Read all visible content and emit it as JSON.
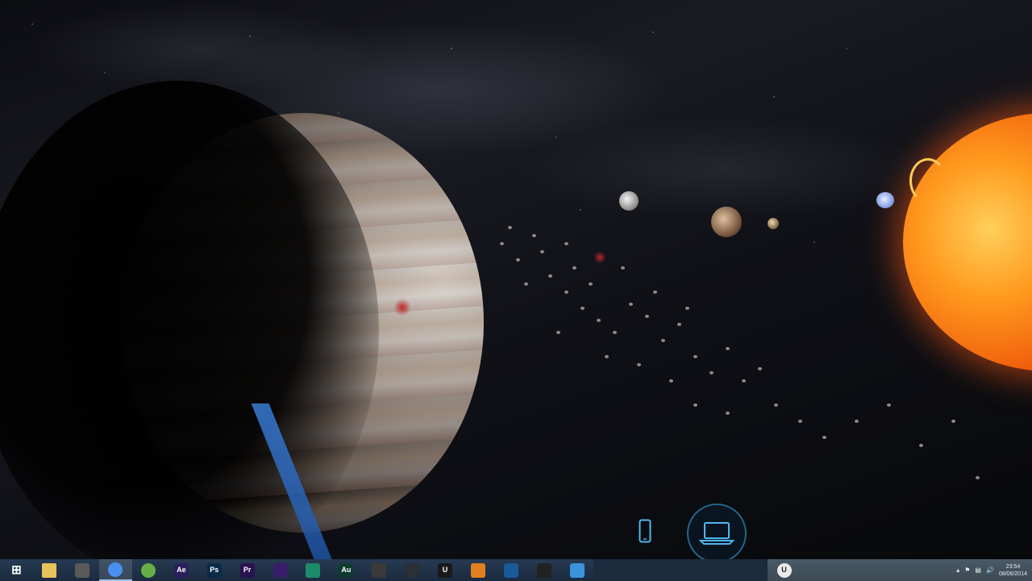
{
  "scene": {
    "description_icons": [
      "phone-icon",
      "laptop-icon"
    ]
  },
  "taskbar": {
    "apps": [
      {
        "id": "start",
        "icon": "windows-start-icon",
        "label": "",
        "color": "#ffffff"
      },
      {
        "id": "explorer",
        "icon": "folder-icon",
        "label": "",
        "color": "#e8c35a"
      },
      {
        "id": "app3",
        "icon": "app-icon",
        "label": "",
        "color": "#5a5a5a"
      },
      {
        "id": "chrome",
        "icon": "chrome-icon",
        "label": "",
        "color": "#4a8ef0"
      },
      {
        "id": "utorrent",
        "icon": "utorrent-icon",
        "label": "",
        "color": "#64b046"
      },
      {
        "id": "after-effects",
        "icon": "after-effects-icon",
        "label": "Ae",
        "color": "#2a1f5a"
      },
      {
        "id": "photoshop",
        "icon": "photoshop-icon",
        "label": "Ps",
        "color": "#0a2a4a"
      },
      {
        "id": "premiere",
        "icon": "premiere-icon",
        "label": "Pr",
        "color": "#2a1250"
      },
      {
        "id": "app9",
        "icon": "app-icon",
        "label": "",
        "color": "#3a1d6a"
      },
      {
        "id": "app10",
        "icon": "app-icon",
        "label": "",
        "color": "#1d8a6a"
      },
      {
        "id": "audition",
        "icon": "audition-icon",
        "label": "Au",
        "color": "#0d3b2e"
      },
      {
        "id": "app12",
        "icon": "app-icon",
        "label": "",
        "color": "#3a3a3a"
      },
      {
        "id": "steam",
        "icon": "steam-icon",
        "label": "",
        "color": "#2b2f36"
      },
      {
        "id": "unreal",
        "icon": "unreal-icon",
        "label": "U",
        "color": "#1a1a1a"
      },
      {
        "id": "media-player",
        "icon": "media-player-icon",
        "label": "",
        "color": "#e08020"
      },
      {
        "id": "app16",
        "icon": "app-icon",
        "label": "",
        "color": "#1a5a9a"
      },
      {
        "id": "app17",
        "icon": "app-icon",
        "label": "",
        "color": "#222222"
      },
      {
        "id": "twitter",
        "icon": "twitter-icon",
        "label": "",
        "color": "#3b94d9"
      }
    ],
    "active_app": "chrome",
    "right_app": {
      "id": "unreal-editor",
      "icon": "unreal-icon",
      "label": "U"
    },
    "tray": {
      "time": "23:54",
      "date": "08/06/2014",
      "icons": [
        "show-hidden-icons-icon",
        "flag-icon",
        "network-icon",
        "volume-icon"
      ]
    }
  }
}
